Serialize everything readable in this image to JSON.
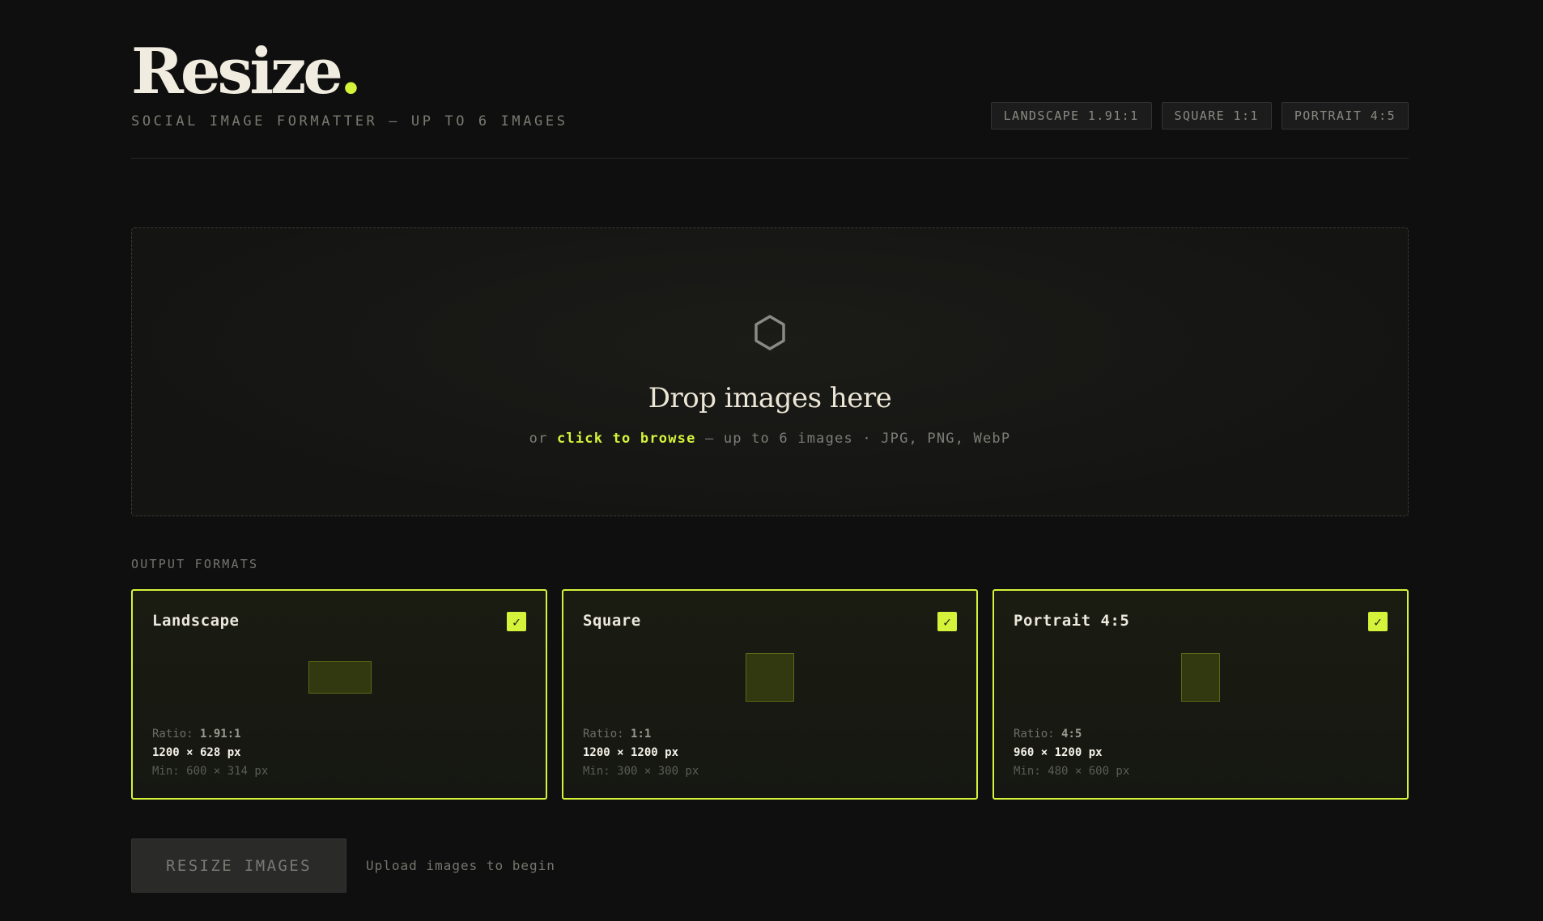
{
  "header": {
    "brand": "Resize",
    "brand_dot": ".",
    "tagline": "SOCIAL IMAGE FORMATTER — UP TO 6 IMAGES",
    "chips": [
      "LANDSCAPE 1.91:1",
      "SQUARE 1:1",
      "PORTRAIT 4:5"
    ]
  },
  "dropzone": {
    "icon": "hexagon-icon",
    "title": "Drop images here",
    "sub_prefix": "or ",
    "browse_label": "click to browse",
    "sub_suffix": " — up to 6 images · JPG, PNG, WebP"
  },
  "formats": {
    "label": "OUTPUT FORMATS",
    "cards": [
      {
        "title": "Landscape",
        "ratio_label": "Ratio: ",
        "ratio": "1.91:1",
        "dims": "1200 × 628 px",
        "min": "Min: 600 × 314 px",
        "checked": "✓"
      },
      {
        "title": "Square",
        "ratio_label": "Ratio: ",
        "ratio": "1:1",
        "dims": "1200 × 1200 px",
        "min": "Min: 300 × 300 px",
        "checked": "✓"
      },
      {
        "title": "Portrait 4:5",
        "ratio_label": "Ratio: ",
        "ratio": "4:5",
        "dims": "960 × 1200 px",
        "min": "Min: 480 × 600 px",
        "checked": "✓"
      }
    ]
  },
  "actions": {
    "resize_label": "RESIZE IMAGES",
    "status": "Upload images to begin"
  },
  "colors": {
    "accent": "#d4f33a",
    "background": "#0f0f0f"
  }
}
